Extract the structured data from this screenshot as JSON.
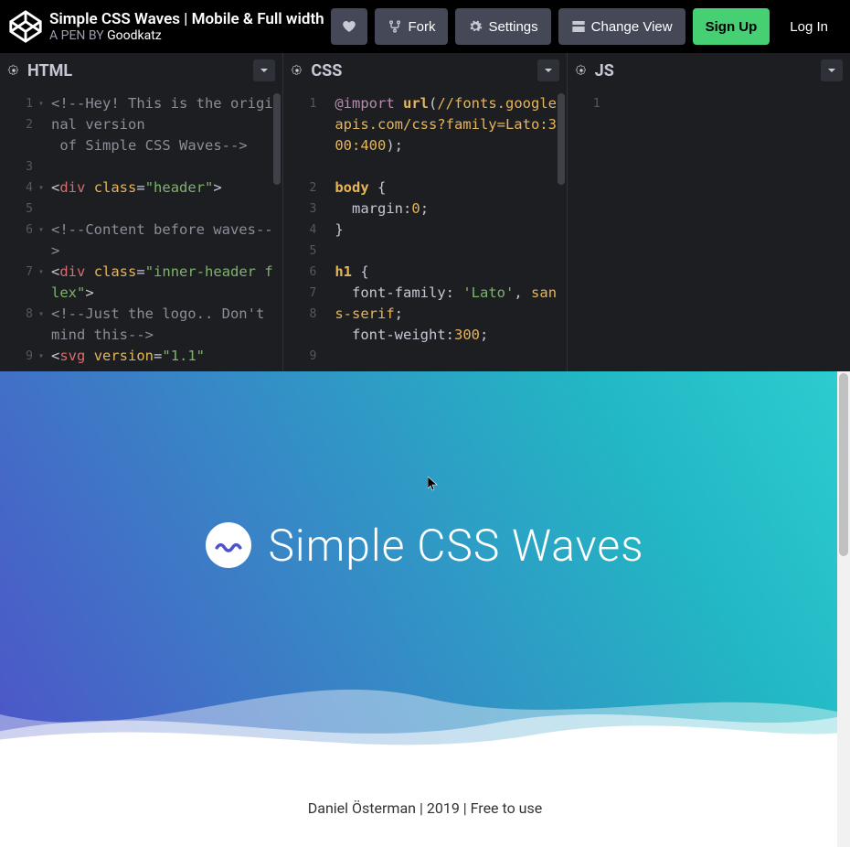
{
  "header": {
    "title": "Simple CSS Waves | Mobile & Full width",
    "byline_prefix": "A PEN BY ",
    "author": "Goodkatz",
    "fork": "Fork",
    "settings": "Settings",
    "change_view": "Change View",
    "signup": "Sign Up",
    "login": "Log In"
  },
  "panels": {
    "html": {
      "title": "HTML"
    },
    "css": {
      "title": "CSS"
    },
    "js": {
      "title": "JS"
    }
  },
  "code_html": {
    "lines": [
      "1",
      "2",
      "3",
      "4",
      "5",
      "6",
      "7",
      "8",
      "9"
    ],
    "l1a": "<!--Hey! This is the ",
    "l1b": "original version",
    "l2": " of Simple CSS Waves-->",
    "l4": "<div class=\"header\">",
    "l6": "<!--Content before waves-->",
    "l7": "<div class=\"inner-header flex\">",
    "l8": "<!--Just the logo.. Don't mind this-->",
    "l9": "<svg version=\"1.1\""
  },
  "code_css": {
    "lines": [
      "1",
      "2",
      "3",
      "4",
      "5",
      "6",
      "7",
      "8",
      "9"
    ],
    "l1a": "@import",
    "l1b": "url(//fonts.googleapis.com/css?family=Lato:300:400);",
    "l3": "body {",
    "l4a": "margin",
    "l4b": "0",
    "l5": "}",
    "l7": "h1 {",
    "l8a": "font-family",
    "l8b": "'Lato', sans-serif",
    "l9a": "font-weight",
    "l9b": "300"
  },
  "code_js": {
    "lines": [
      "1"
    ]
  },
  "preview": {
    "title": "Simple CSS Waves",
    "footer": "Daniel Österman | 2019 | Free to use"
  }
}
